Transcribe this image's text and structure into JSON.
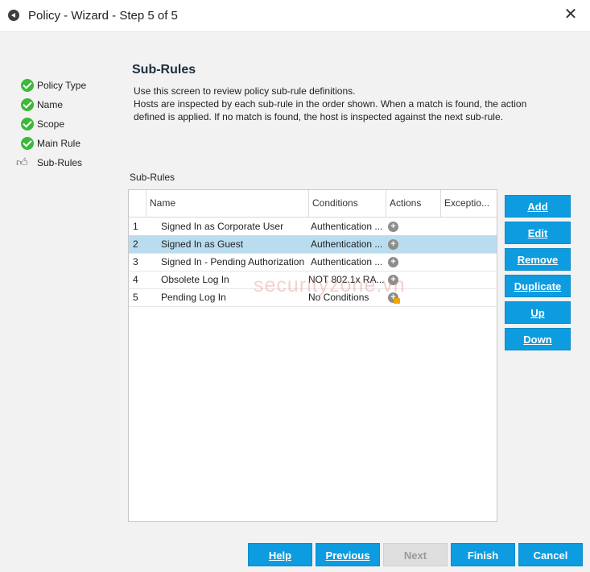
{
  "window": {
    "title": "Policy - Wizard - Step 5 of 5",
    "close_label": "✕"
  },
  "steps": [
    {
      "label": "Policy Type",
      "state": "done"
    },
    {
      "label": "Name",
      "state": "done"
    },
    {
      "label": "Scope",
      "state": "done"
    },
    {
      "label": "Main Rule",
      "state": "done"
    },
    {
      "label": "Sub-Rules",
      "state": "current"
    }
  ],
  "main": {
    "heading": "Sub-Rules",
    "description": [
      "Use this screen to review policy sub-rule definitions.",
      "Hosts are inspected by each sub-rule in the order shown. When a match is found, the action",
      "defined is applied. If no match is found, the host is inspected against the next sub-rule."
    ],
    "section_label": "Sub-Rules"
  },
  "table": {
    "columns": [
      "Name",
      "Conditions",
      "Actions",
      "Exceptio..."
    ],
    "rows": [
      {
        "num": "1",
        "name": "Signed In as Corporate User",
        "conditions": "Authentication ...",
        "selected": false,
        "lock": false
      },
      {
        "num": "2",
        "name": "Signed In as Guest",
        "conditions": "Authentication ...",
        "selected": true,
        "lock": false
      },
      {
        "num": "3",
        "name": "Signed In - Pending Authorization",
        "conditions": "Authentication ...",
        "selected": false,
        "lock": false
      },
      {
        "num": "4",
        "name": "Obsolete Log In",
        "conditions": "NOT  802.1x RA...",
        "selected": false,
        "lock": false
      },
      {
        "num": "5",
        "name": "Pending Log In",
        "conditions": "No Conditions",
        "selected": false,
        "lock": true
      }
    ]
  },
  "side_buttons": [
    {
      "key": "add",
      "label": "Add"
    },
    {
      "key": "edit",
      "label": "Edit"
    },
    {
      "key": "remove",
      "label": "Remove"
    },
    {
      "key": "duplicate",
      "label": "Duplicate"
    },
    {
      "key": "up",
      "label": "Up"
    },
    {
      "key": "down",
      "label": "Down"
    }
  ],
  "footer": {
    "help": "Help",
    "previous": "Previous",
    "next": "Next",
    "finish": "Finish",
    "cancel": "Cancel"
  },
  "watermark": "securityzone.vn",
  "colors": {
    "accent": "#0d9ce0",
    "selected_row": "#b9ddee",
    "check": "#3cb83a"
  }
}
